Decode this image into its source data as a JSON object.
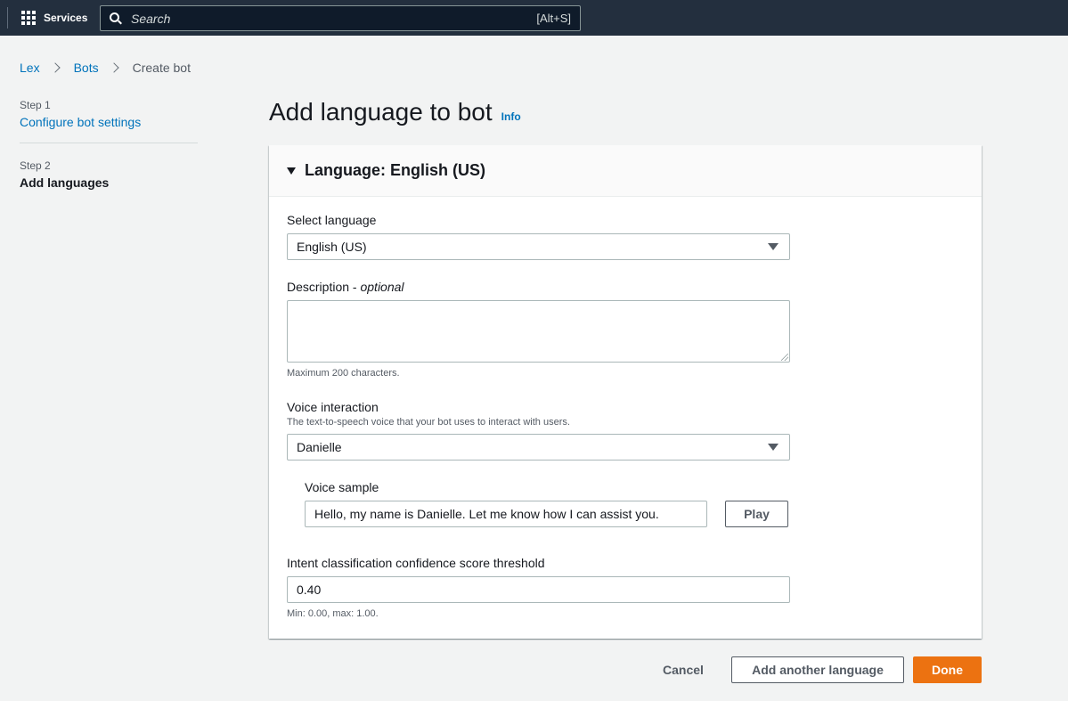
{
  "topbar": {
    "services_label": "Services",
    "search_placeholder": "Search",
    "search_shortcut": "[Alt+S]"
  },
  "breadcrumb": {
    "items": [
      "Lex",
      "Bots"
    ],
    "current": "Create bot"
  },
  "steps": [
    {
      "label": "Step 1",
      "title": "Configure bot settings"
    },
    {
      "label": "Step 2",
      "title": "Add languages"
    }
  ],
  "page": {
    "title": "Add language to bot",
    "info": "Info"
  },
  "panel": {
    "title": "Language: English (US)",
    "select_language": {
      "label": "Select language",
      "value": "English (US)"
    },
    "description": {
      "label": "Description",
      "optional": "optional",
      "separator": " - ",
      "hint": "Maximum 200 characters.",
      "value": ""
    },
    "voice": {
      "label": "Voice interaction",
      "hint": "The text-to-speech voice that your bot uses to interact with users.",
      "value": "Danielle"
    },
    "voice_sample": {
      "label": "Voice sample",
      "value": "Hello, my name is Danielle. Let me know how I can assist you.",
      "play": "Play"
    },
    "threshold": {
      "label": "Intent classification confidence score threshold",
      "value": "0.40",
      "hint": "Min: 0.00, max: 1.00."
    }
  },
  "footer": {
    "cancel": "Cancel",
    "add_another": "Add another language",
    "done": "Done"
  }
}
